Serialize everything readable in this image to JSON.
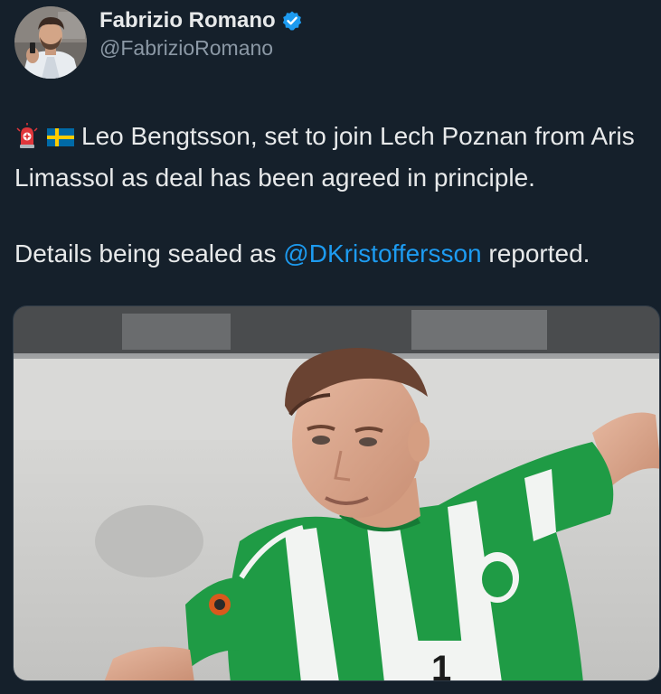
{
  "author": {
    "display_name": "Fabrizio Romano",
    "handle": "@FabrizioRomano",
    "verified": true,
    "avatar_icon": "profile-photo-avatar",
    "verified_icon": "verified-badge-icon"
  },
  "tweet": {
    "emojis": [
      "rotating-light-emoji",
      "sweden-flag-emoji"
    ],
    "line1": "Leo Bengtsson, set to join Lech Poznan from Aris Limassol as deal has been agreed in principle.",
    "line2_before": "Details being sealed as ",
    "mention": "@DKristoffersson",
    "line2_after": " reported."
  },
  "media": {
    "type": "photo",
    "description_icon": "football-player-photo"
  },
  "colors": {
    "background": "#15202b",
    "text": "#e7e9ea",
    "secondary": "#8b98a5",
    "accent": "#1d9bf0"
  }
}
